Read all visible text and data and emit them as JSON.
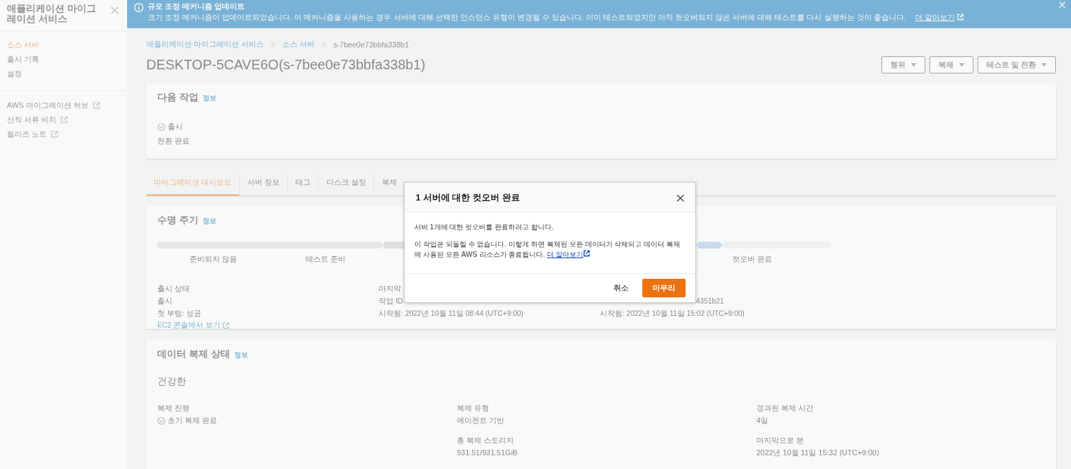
{
  "sidebar": {
    "title": "애플리케이션 마이그레이션 서비스",
    "items": [
      {
        "label": "소스 서버",
        "selected": true
      },
      {
        "label": "출시 기록",
        "selected": false
      },
      {
        "label": "설정",
        "selected": false
      }
    ],
    "links": [
      {
        "label": "AWS 마이그레이션 허브"
      },
      {
        "label": "선적 서류 비치"
      },
      {
        "label": "릴리즈 노트"
      }
    ]
  },
  "banner": {
    "title": "규모 조정 메커니즘 업데이트",
    "text": "크기 조정 메커니즘이 업데이트되었습니다. 이 메커니즘을 사용하는 경우 서버에 대해 선택한 인스턴스 유형이 변경될 수 있습니다. 이미 테스트되었지만 아직 컷오버되지 않은 서버에 대해 테스트를 다시 실행하는 것이 좋습니다.",
    "link": "더 알아보기"
  },
  "breadcrumb": [
    "애플리케이션 마이그레이션 서비스",
    "소스 서버",
    "s-7bee0e73bbfa338b1"
  ],
  "title": "DESKTOP-5CAVE6O(s-7bee0e73bbfa338b1)",
  "actions": [
    "행위",
    "복제",
    "테스트 및 전환"
  ],
  "next_action": {
    "title": "다음 작업",
    "info": "정보",
    "status": "출시",
    "text": "전환 완료"
  },
  "tabs": [
    {
      "label": "마이그레이션 대시보드",
      "selected": true
    },
    {
      "label": "서버 정보",
      "selected": false
    },
    {
      "label": "태그",
      "selected": false
    },
    {
      "label": "디스크 설정",
      "selected": false
    },
    {
      "label": "복제",
      "selected": false
    }
  ],
  "lifecycle": {
    "title": "수명 주기",
    "info": "정보",
    "steps": [
      "준비되지 않음",
      "테스트 준비",
      "컷오버 완료"
    ],
    "launch": {
      "label": "출시 상태",
      "lines": [
        "출시",
        "첫 부팅: 성공"
      ],
      "link": "EC2 콘솔에서 보기"
    },
    "last_job": {
      "label": "마지막",
      "job": "작업 ID",
      "started": "시작됨: 2022년 10월 11일 08:44 (UTC+9:00)"
    },
    "column_3": {
      "job": "4351b21",
      "started": "시작됨: 2022년 10월 11일 15:02 (UTC+9:00)"
    }
  },
  "replication": {
    "title": "데이터 복제 상태",
    "info": "정보",
    "health": "건강한",
    "progress": {
      "label": "복제 진행",
      "value": "초기 복제 완료"
    },
    "fields": [
      {
        "label": "복제 유형",
        "value": "에이전트 기반"
      },
      {
        "label": "경과된 복제 시간",
        "value": "4일"
      },
      {
        "label": "총 복제 스토리지",
        "value": "931.51/931.51GiB"
      },
      {
        "label": "마지막으로 본",
        "value": "2022년 10월 11일 15:32 (UTC+9:00)"
      }
    ]
  },
  "modal": {
    "title": "1 서버에 대한 컷오버 완료",
    "line1": "서버 1개에 대한 컷오버를 완료하려고 합니다.",
    "line2": "이 작업은 되돌릴 수 없습니다. 이렇게 하면 복제된 모든 데이터가 삭제되고 데이터 복제에 사용된 모든 AWS 리소스가 종료됩니다.",
    "link": "더 알아보기",
    "cancel": "취소",
    "confirm": "마무리"
  }
}
